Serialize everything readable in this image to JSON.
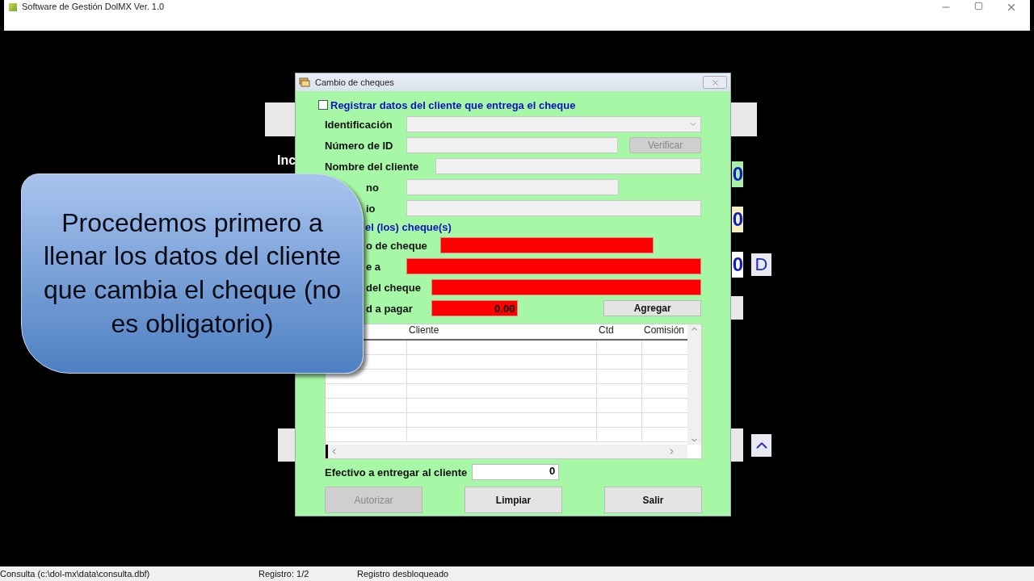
{
  "app_window": {
    "title": "Software de Gestión DolMX Ver. 1.0"
  },
  "background": {
    "label_fragment": "Inc",
    "value_boxes": [
      {
        "text": "0",
        "color": "#a8f0a8"
      },
      {
        "text": "0",
        "color": "#f4f0c0"
      },
      {
        "text": "0",
        "color": "#ffffff"
      }
    ],
    "side_button": "D"
  },
  "dialog": {
    "title": "Cambio de cheques",
    "register_checkbox": {
      "label": "Registrar datos del cliente que entrega el cheque",
      "checked": false
    },
    "client_fields": [
      {
        "label": "Identificación",
        "kind": "select"
      },
      {
        "label": "Número de ID",
        "kind": "short",
        "button": {
          "label": "Verificar",
          "disabled": true
        }
      },
      {
        "label": "Nombre del cliente",
        "kind": "text"
      },
      {
        "label": "no",
        "kind": "short"
      },
      {
        "label": "io",
        "kind": "text"
      }
    ],
    "cheque_section": {
      "title": "el (los) cheque(s)",
      "fields": [
        {
          "label": "o de cheque",
          "kind": "short"
        },
        {
          "label": "e a",
          "kind": "text"
        },
        {
          "label": "del cheque",
          "kind": "text"
        },
        {
          "label": "d a pagar",
          "kind": "amount",
          "value": "0.00",
          "button": {
            "label": "Agregar",
            "disabled": false
          }
        }
      ]
    },
    "table": {
      "columns": [
        "Cliente",
        "Ctd",
        "Comisión"
      ]
    },
    "cash": {
      "label": "Efectivo a entregar al cliente",
      "value": "0"
    },
    "buttons": [
      {
        "label": "Autorizar",
        "disabled": true
      },
      {
        "label": "Limpiar",
        "disabled": false
      },
      {
        "label": "Salir",
        "disabled": false
      }
    ]
  },
  "callout": {
    "text": "Procedemos primero a llenar los datos del cliente que cambia el cheque (no es obligatorio)"
  },
  "status_bar": [
    "Consulta (c:\\dol-mx\\data\\consulta.dbf)",
    "Registro: 1/2",
    "Registro desbloqueado"
  ]
}
